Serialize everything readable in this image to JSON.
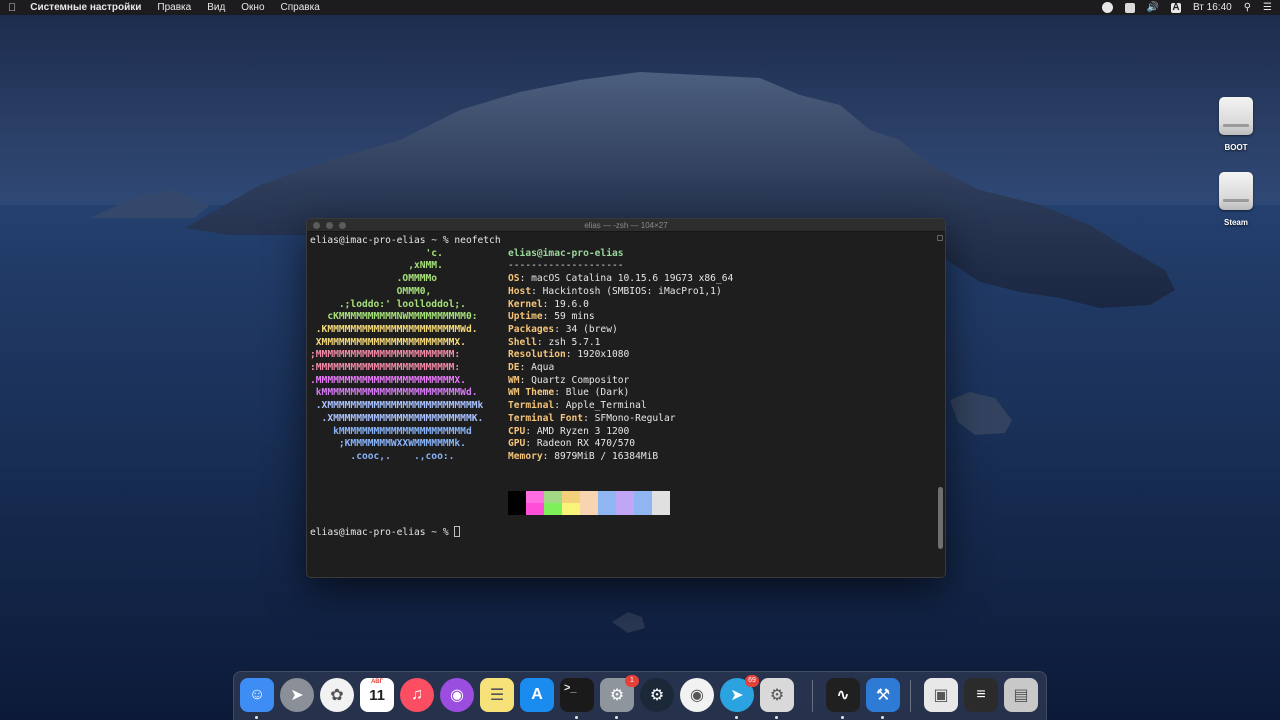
{
  "menubar": {
    "apple_icon": "apple-logo-icon",
    "app_name": "Системные настройки",
    "menus": [
      "Правка",
      "Вид",
      "Окно",
      "Справка"
    ],
    "status": {
      "clock": "Вт 16:40",
      "input_source": "A",
      "volume_icon": "volume-icon",
      "spotlight_icon": "search-icon",
      "control_icon": "list-icon"
    }
  },
  "desktop": {
    "icons": [
      "BOOT",
      "Steam"
    ]
  },
  "terminal": {
    "title": "elias — -zsh — 104×27",
    "prompt_first": "elias@imac-pro-elias ~ % neofetch",
    "logo": [
      "                    'c.",
      "                 ,xNMM.",
      "               .OMMMMo",
      "               OMMM0,",
      "     .;loddo:' loolloddol;.",
      "   cKMMMMMMMMMMNWMMMMMMMMMM0:",
      " .KMMMMMMMMMMMMMMMMMMMMMMMWd.",
      " XMMMMMMMMMMMMMMMMMMMMMMMX.",
      ";MMMMMMMMMMMMMMMMMMMMMMMM:",
      ":MMMMMMMMMMMMMMMMMMMMMMMM:",
      ".MMMMMMMMMMMMMMMMMMMMMMMMX.",
      " kMMMMMMMMMMMMMMMMMMMMMMMMWd.",
      " .XMMMMMMMMMMMMMMMMMMMMMMMMMMk",
      "  .XMMMMMMMMMMMMMMMMMMMMMMMMK.",
      "    kMMMMMMMMMMMMMMMMMMMMMMd",
      "     ;KMMMMMMMWXXWMMMMMMMk.",
      "       .cooc,.    .,coo:."
    ],
    "logo_colors": [
      "#a6e07a",
      "#a6e07a",
      "#a6e07a",
      "#a6e07a",
      "#a6e07a",
      "#a6e07a",
      "#f5d97a",
      "#f5d97a",
      "#f38ba8",
      "#f38ba8",
      "#e879f9",
      "#d77cf5",
      "#a9c2ff",
      "#a9c2ff",
      "#89b4fa",
      "#89b4fa",
      "#89b4fa"
    ],
    "user_host": "elias@imac-pro-elias",
    "separator": "--------------------",
    "info": [
      {
        "key": "OS",
        "value": "macOS Catalina 10.15.6 19G73 x86_64"
      },
      {
        "key": "Host",
        "value": "Hackintosh (SMBIOS: iMacPro1,1)"
      },
      {
        "key": "Kernel",
        "value": "19.6.0"
      },
      {
        "key": "Uptime",
        "value": "59 mins"
      },
      {
        "key": "Packages",
        "value": "34 (brew)"
      },
      {
        "key": "Shell",
        "value": "zsh 5.7.1"
      },
      {
        "key": "Resolution",
        "value": "1920x1080"
      },
      {
        "key": "DE",
        "value": "Aqua"
      },
      {
        "key": "WM",
        "value": "Quartz Compositor"
      },
      {
        "key": "WM Theme",
        "value": "Blue (Dark)"
      },
      {
        "key": "Terminal",
        "value": "Apple_Terminal"
      },
      {
        "key": "Terminal Font",
        "value": "SFMono-Regular"
      },
      {
        "key": "CPU",
        "value": "AMD Ryzen 3 1200"
      },
      {
        "key": "GPU",
        "value": "Radeon RX 470/570"
      },
      {
        "key": "Memory",
        "value": "8979MiB / 16384MiB"
      }
    ],
    "palette": [
      "#000000",
      "#ff6ee0",
      "#a3d986",
      "#f4d07a",
      "#f9d4b0",
      "#8fb6f3",
      "#c1a6f5",
      "#8fb6f3",
      "#e0e0e0"
    ],
    "palette_bottom": [
      "#000000",
      "#ff4fd8",
      "#7ef05a",
      "#f8f47a",
      "#f9d4b0",
      "#8fb6f3",
      "#c1a6f5",
      "#8fb6f3",
      "#e0e0e0"
    ],
    "prompt_last": "elias@imac-pro-elias ~ % "
  },
  "dock": {
    "apps": [
      {
        "name": "finder",
        "color": "#3d8df5"
      },
      {
        "name": "launchpad",
        "color": "#8a8f98"
      },
      {
        "name": "photos",
        "color": "#f2f2f2"
      },
      {
        "name": "calendar",
        "color": "#ffffff",
        "label": "11",
        "sublabel": "АВГ"
      },
      {
        "name": "music",
        "color": "#fb4e63"
      },
      {
        "name": "podcasts",
        "color": "#9b4de0"
      },
      {
        "name": "notes",
        "color": "#f7e27a"
      },
      {
        "name": "app-store",
        "color": "#1a8cf0"
      },
      {
        "name": "terminal",
        "color": "#1a1a1a",
        "label": ">_"
      },
      {
        "name": "system-preferences",
        "color": "#8f959c",
        "badge": "1"
      },
      {
        "name": "steam",
        "color": "#1b2838"
      },
      {
        "name": "chrome",
        "color": "#f2f2f2"
      },
      {
        "name": "telegram",
        "color": "#2aa3e0",
        "badge": "69"
      },
      {
        "name": "kext-utility",
        "color": "#d9d9d9"
      },
      {
        "name": "activity-monitor",
        "color": "#202020"
      },
      {
        "name": "xcode",
        "color": "#2e7bd6"
      },
      {
        "name": "preview",
        "color": "#e8e8e8"
      },
      {
        "name": "calculator",
        "color": "#2b2b2b"
      },
      {
        "name": "trash",
        "color": "#c8c8c8"
      }
    ]
  }
}
